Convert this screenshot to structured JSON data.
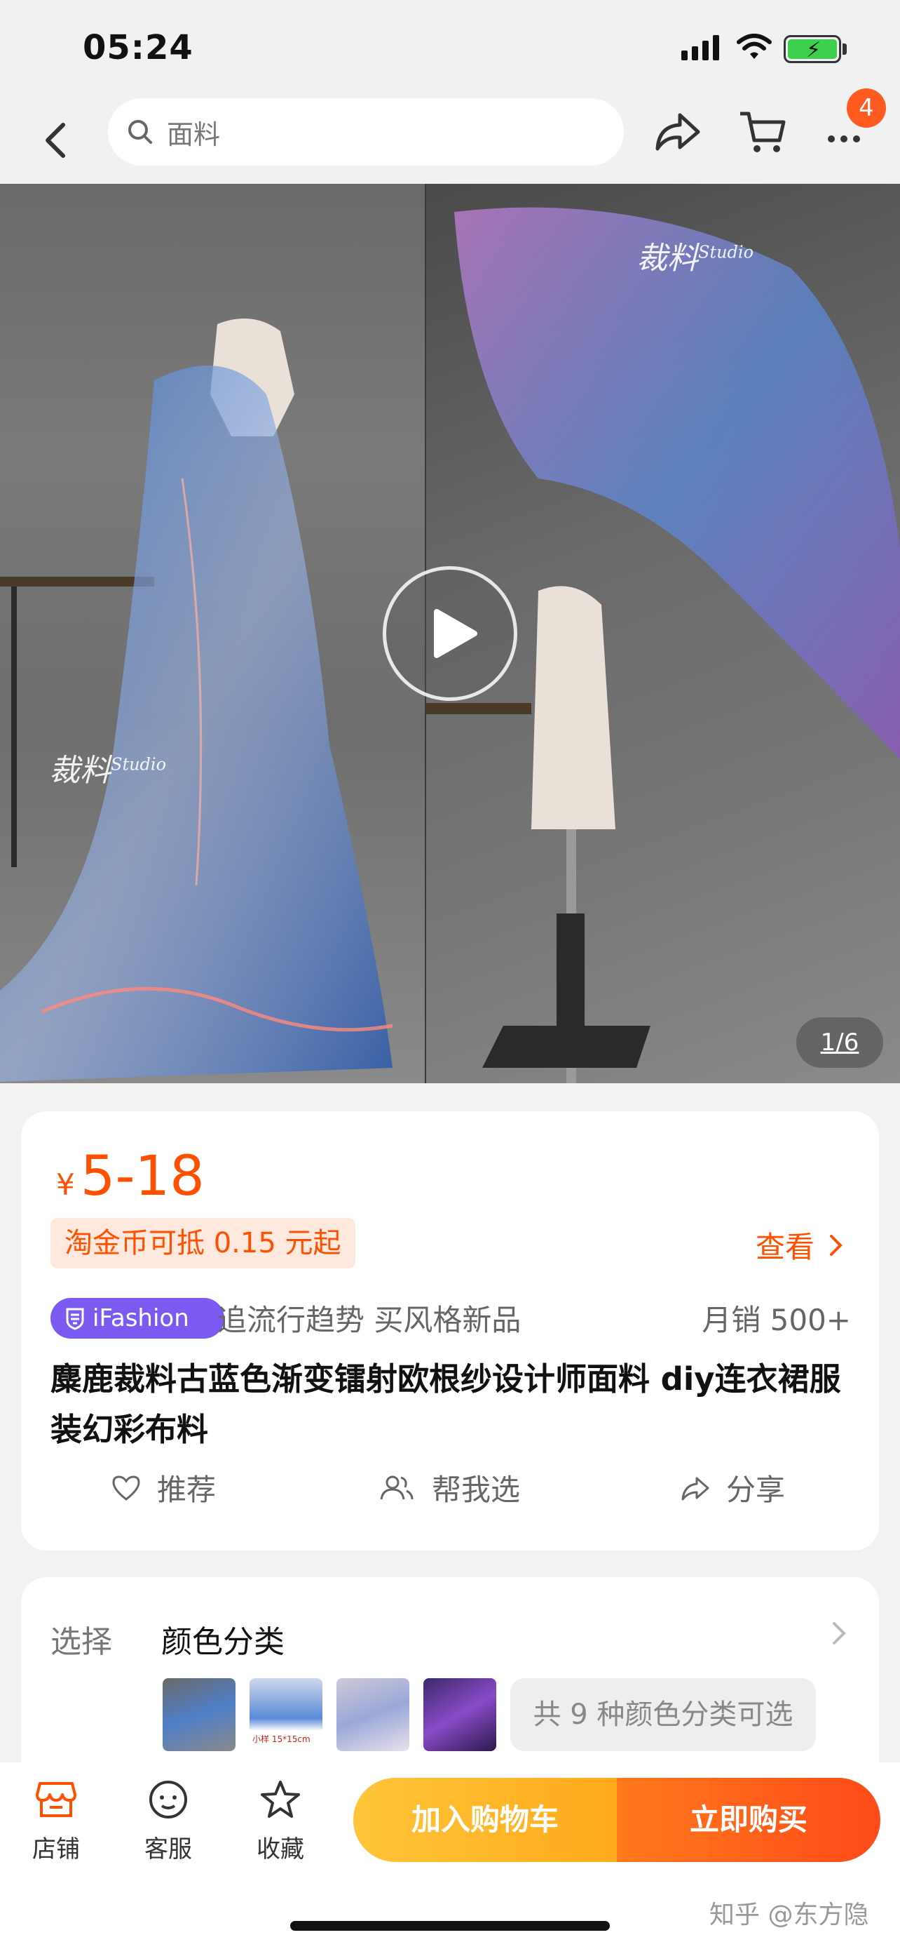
{
  "status_bar": {
    "time": "05:24"
  },
  "nav": {
    "search_placeholder": "面料",
    "badge_count": "4"
  },
  "gallery": {
    "counter": "1/6",
    "watermark_main": "裁料",
    "watermark_sub": "Studio"
  },
  "product": {
    "currency": "¥",
    "price": "5-18",
    "coin_tag": "淘金币可抵 0.15 元起",
    "view_label": "查看",
    "brand_badge": "iFashion",
    "slogan": "追流行趋势 买风格新品",
    "sales": "月销  500+",
    "title": "麋鹿裁料古蓝色渐变镭射欧根纱设计师面料 diy连衣裙服装幻彩布料",
    "actions": {
      "recommend": "推荐",
      "help_choose": "帮我选",
      "share": "分享"
    }
  },
  "selection": {
    "label": "选择",
    "category": "颜色分类",
    "thumb_caption": "小样 15*15cm",
    "more_options": "共 9 种颜色分类可选"
  },
  "bottom_bar": {
    "store": "店铺",
    "service": "客服",
    "favorite": "收藏",
    "add_to_cart": "加入购物车",
    "buy_now": "立即购买"
  },
  "watermark": "知乎 @东方隐",
  "colors": {
    "accent": "#ff5000",
    "cart_button": "#ffb12a",
    "buy_button": "#ff5a1a",
    "ifashion": "#7b5af2"
  }
}
